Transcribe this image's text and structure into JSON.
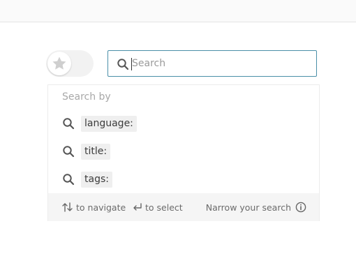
{
  "toggle": {
    "icon": "star-icon",
    "state": "off"
  },
  "search": {
    "placeholder": "Search",
    "value": ""
  },
  "dropdown": {
    "heading": "Search by",
    "options": [
      {
        "icon": "search-icon",
        "label": "language:"
      },
      {
        "icon": "search-icon",
        "label": "title:"
      },
      {
        "icon": "search-icon",
        "label": "tags:"
      }
    ],
    "footer": {
      "navigate": "to navigate",
      "select": "to select",
      "narrow": "Narrow your search"
    }
  },
  "colors": {
    "focus_border": "#4a8fa8",
    "footer_bg": "#f5f5f5",
    "chip_bg": "#efefef",
    "muted_text": "#a8a8a8"
  }
}
